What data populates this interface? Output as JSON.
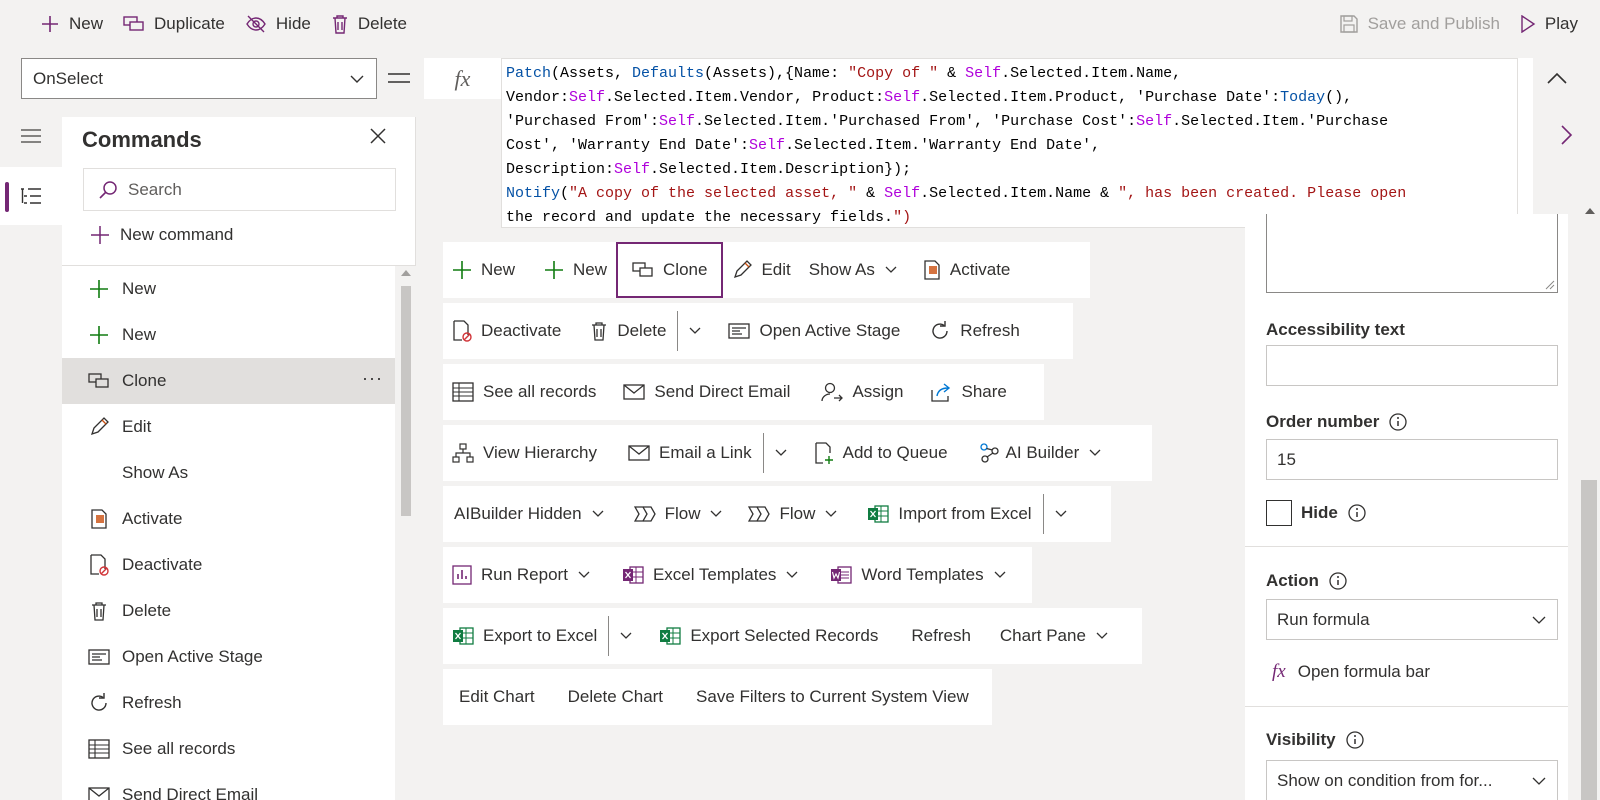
{
  "toolbar": {
    "new": "New",
    "duplicate": "Duplicate",
    "hide": "Hide",
    "delete": "Delete",
    "save_publish": "Save and Publish",
    "play": "Play"
  },
  "formula_bar": {
    "property": "OnSelect",
    "fx_label": "fx",
    "lines": [
      "Patch(Assets, Defaults(Assets),{Name: \"Copy of \" & Self.Selected.Item.Name,",
      "Vendor:Self.Selected.Item.Vendor, Product:Self.Selected.Item.Product, 'Purchase Date':Today(),",
      "'Purchased From':Self.Selected.Item.'Purchased From', 'Purchase Cost':Self.Selected.Item.'Purchase",
      "Cost', 'Warranty End Date':Self.Selected.Item.'Warranty End Date',",
      "Description:Self.Selected.Item.Description});",
      "Notify(\"A copy of the selected asset, \" & Self.Selected.Item.Name & \", has been created. Please open",
      "the record and update the necessary fields.\")"
    ]
  },
  "panel": {
    "title": "Commands",
    "search_placeholder": "Search",
    "new_command": "New command",
    "items": [
      {
        "label": "New",
        "icon": "plus-icon"
      },
      {
        "label": "New",
        "icon": "plus-icon"
      },
      {
        "label": "Clone",
        "icon": "clone-icon",
        "selected": true,
        "more": "···"
      },
      {
        "label": "Edit",
        "icon": "pencil-icon"
      },
      {
        "label": "Show As",
        "icon": ""
      },
      {
        "label": "Activate",
        "icon": "activate-icon"
      },
      {
        "label": "Deactivate",
        "icon": "deactivate-icon"
      },
      {
        "label": "Delete",
        "icon": "trash-icon"
      },
      {
        "label": "Open Active Stage",
        "icon": "stage-icon"
      },
      {
        "label": "Refresh",
        "icon": "refresh-icon"
      },
      {
        "label": "See all records",
        "icon": "table-icon"
      },
      {
        "label": "Send Direct Email",
        "icon": "email-icon"
      }
    ]
  },
  "canvas": {
    "rows": [
      [
        "New",
        "New",
        "Clone",
        "Edit",
        "Show As",
        "Activate"
      ],
      [
        "Deactivate",
        "Delete",
        "Open Active Stage",
        "Refresh"
      ],
      [
        "See all records",
        "Send Direct Email",
        "Assign",
        "Share"
      ],
      [
        "View Hierarchy",
        "Email a Link",
        "Add to Queue",
        "AI Builder"
      ],
      [
        "AIBuilder Hidden",
        "Flow",
        "Flow",
        "Import from Excel"
      ],
      [
        "Run Report",
        "Excel Templates",
        "Word Templates"
      ],
      [
        "Export to Excel",
        "Export Selected Records",
        "Refresh",
        "Chart Pane"
      ],
      [
        "Edit Chart",
        "Delete Chart",
        "Save Filters to Current System View"
      ]
    ]
  },
  "properties": {
    "accessibility_label": "Accessibility text",
    "accessibility_value": "",
    "order_label": "Order number",
    "order_value": "15",
    "hide_label": "Hide",
    "action_label": "Action",
    "action_value": "Run formula",
    "open_formula": "Open formula bar",
    "visibility_label": "Visibility",
    "visibility_value": "Show on condition from for..."
  },
  "colors": {
    "accent": "#742774",
    "plus_green": "#107c10",
    "excel_green": "#107c41",
    "orange": "#ca5010",
    "red": "#d13438"
  }
}
